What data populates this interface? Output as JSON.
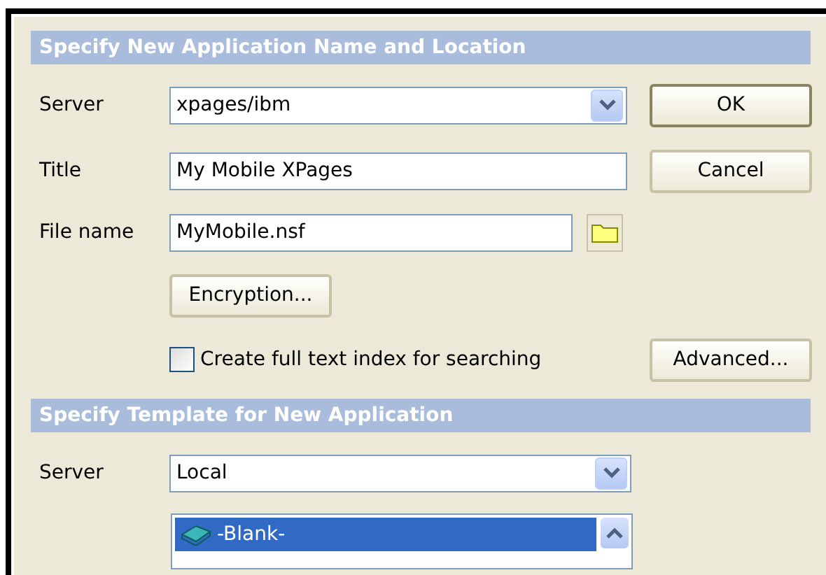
{
  "sections": [
    {
      "title": "Specify New Application Name and Location"
    },
    {
      "title": "Specify Template for New Application"
    }
  ],
  "application": {
    "server": {
      "label": "Server",
      "value": "xpages/ibm"
    },
    "title": {
      "label": "Title",
      "value": "My Mobile XPages"
    },
    "file_name": {
      "label": "File name",
      "value": "MyMobile.nsf"
    },
    "encryption_button": "Encryption...",
    "full_text_index": {
      "label": "Create full text index for searching",
      "checked": false
    },
    "advanced_button": "Advanced..."
  },
  "buttons": [
    "OK",
    "Cancel"
  ],
  "template": {
    "server": {
      "label": "Server",
      "value": "Local"
    },
    "templates": [
      {
        "label": "-Blank-",
        "selected": true
      }
    ]
  }
}
